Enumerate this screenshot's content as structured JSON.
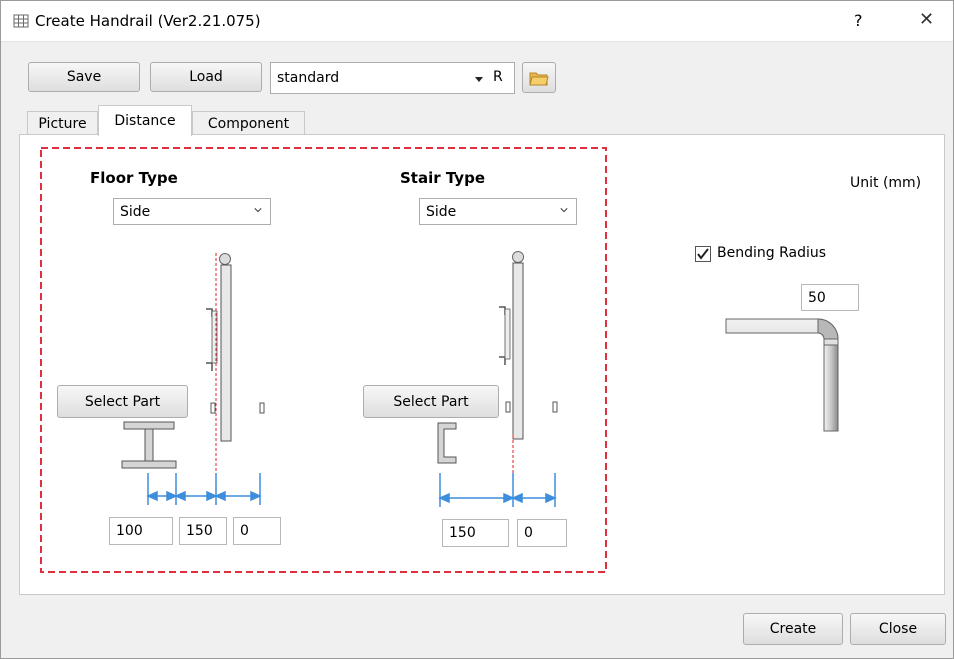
{
  "window": {
    "title": "Create Handrail (Ver2.21.075)",
    "help_label": "?",
    "close_label": "✕"
  },
  "toolbar": {
    "save_label": "Save",
    "load_label": "Load",
    "preset_value": "standard",
    "preset_suffix": "R"
  },
  "tabs": [
    {
      "label": "Picture"
    },
    {
      "label": "Distance"
    },
    {
      "label": "Component"
    }
  ],
  "distance": {
    "unit_label": "Unit (mm)",
    "floor": {
      "heading": "Floor Type",
      "type_value": "Side",
      "select_part_label": "Select Part",
      "dist1": "100",
      "dist2": "150",
      "dist3": "0"
    },
    "stair": {
      "heading": "Stair Type",
      "type_value": "Side",
      "select_part_label": "Select Part",
      "dist1": "150",
      "dist2": "0"
    },
    "bending": {
      "label": "Bending Radius",
      "checked": true,
      "value": "50"
    }
  },
  "footer": {
    "create_label": "Create",
    "close_label": "Close"
  },
  "colors": {
    "dashed_border": "#e03040",
    "dimension": "#3d8edc",
    "centerline": "#e02020"
  }
}
